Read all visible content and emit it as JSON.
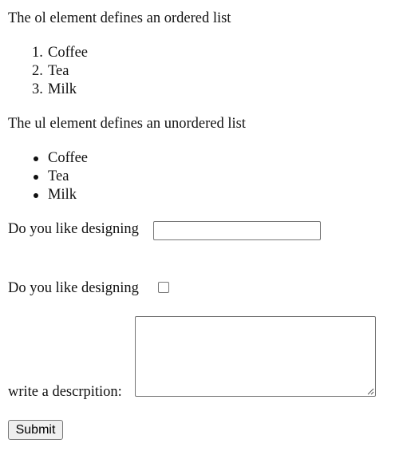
{
  "ordered_section": {
    "intro": "The ol element defines an ordered list",
    "items": [
      {
        "marker": "1.",
        "label": "Coffee"
      },
      {
        "marker": "2.",
        "label": "Tea"
      },
      {
        "marker": "3.",
        "label": "Milk"
      }
    ]
  },
  "unordered_section": {
    "intro": "The ul element defines an unordered list",
    "items": [
      {
        "label": "Coffee"
      },
      {
        "label": "Tea"
      },
      {
        "label": "Milk"
      }
    ]
  },
  "form": {
    "text_question": {
      "label": "Do you like designing",
      "value": "",
      "placeholder": ""
    },
    "checkbox_question": {
      "label": "Do you like designing",
      "checked": false
    },
    "description": {
      "label": "write a descrpition:",
      "value": ""
    },
    "submit_label": "Submit"
  },
  "colors": {
    "text": "#111111",
    "control_border": "#767676",
    "button_bg": "#efefef",
    "background": "#ffffff"
  }
}
